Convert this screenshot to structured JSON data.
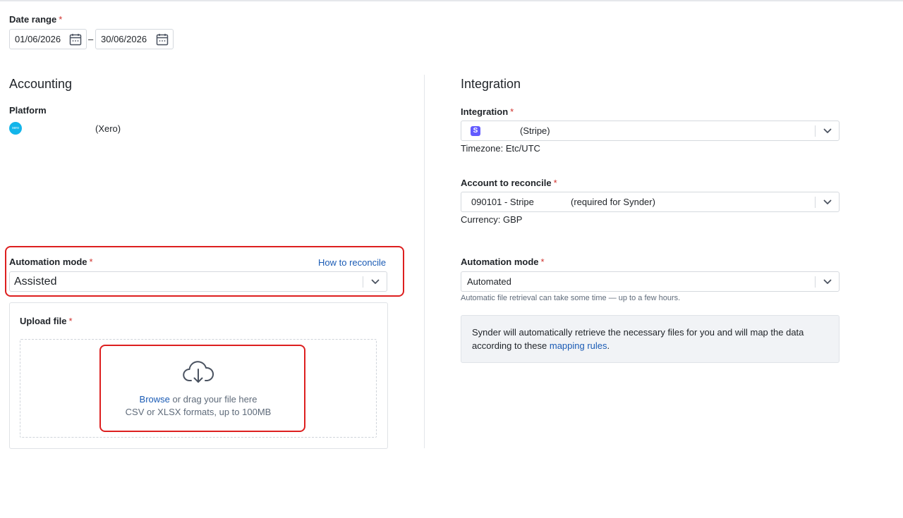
{
  "date_range": {
    "label": "Date range",
    "required_mark": "*",
    "start": "01/06/2026",
    "separator": "–",
    "end": "30/06/2026"
  },
  "accounting": {
    "title": "Accounting",
    "platform_label": "Platform",
    "platform_logo_text": "xero",
    "platform_value": "(Xero)",
    "automation_mode": {
      "label": "Automation mode",
      "required_mark": "*",
      "help_link": "How to reconcile",
      "value": "Assisted"
    },
    "upload": {
      "label": "Upload file",
      "required_mark": "*",
      "browse_link": "Browse",
      "drag_text": " or drag your file here",
      "formats": "CSV or XLSX formats, up to 100MB"
    }
  },
  "integration": {
    "title": "Integration",
    "integration_field": {
      "label": "Integration",
      "required_mark": "*",
      "badge": "S",
      "value": "(Stripe)",
      "timezone": "Timezone: Etc/UTC"
    },
    "account_field": {
      "label": "Account to reconcile",
      "required_mark": "*",
      "value_code": "090101 - Stripe",
      "value_note": "(required for Synder)",
      "currency": "Currency: GBP"
    },
    "automation_mode": {
      "label": "Automation mode",
      "required_mark": "*",
      "value": "Automated",
      "hint": "Automatic file retrieval can take some time — up to a few hours."
    },
    "info": {
      "text": "Synder will automatically retrieve the necessary files for you and will map the data according to these ",
      "link": "mapping rules",
      "tail": "."
    }
  },
  "colors": {
    "highlight": "#dd1f1f",
    "link": "#1a5bb5",
    "xero": "#13b5ea",
    "stripe": "#635bff",
    "required": "#d0312d"
  },
  "icons": {
    "calendar": "calendar-icon",
    "chevron": "chevron-down-icon",
    "upload": "cloud-upload-icon"
  }
}
